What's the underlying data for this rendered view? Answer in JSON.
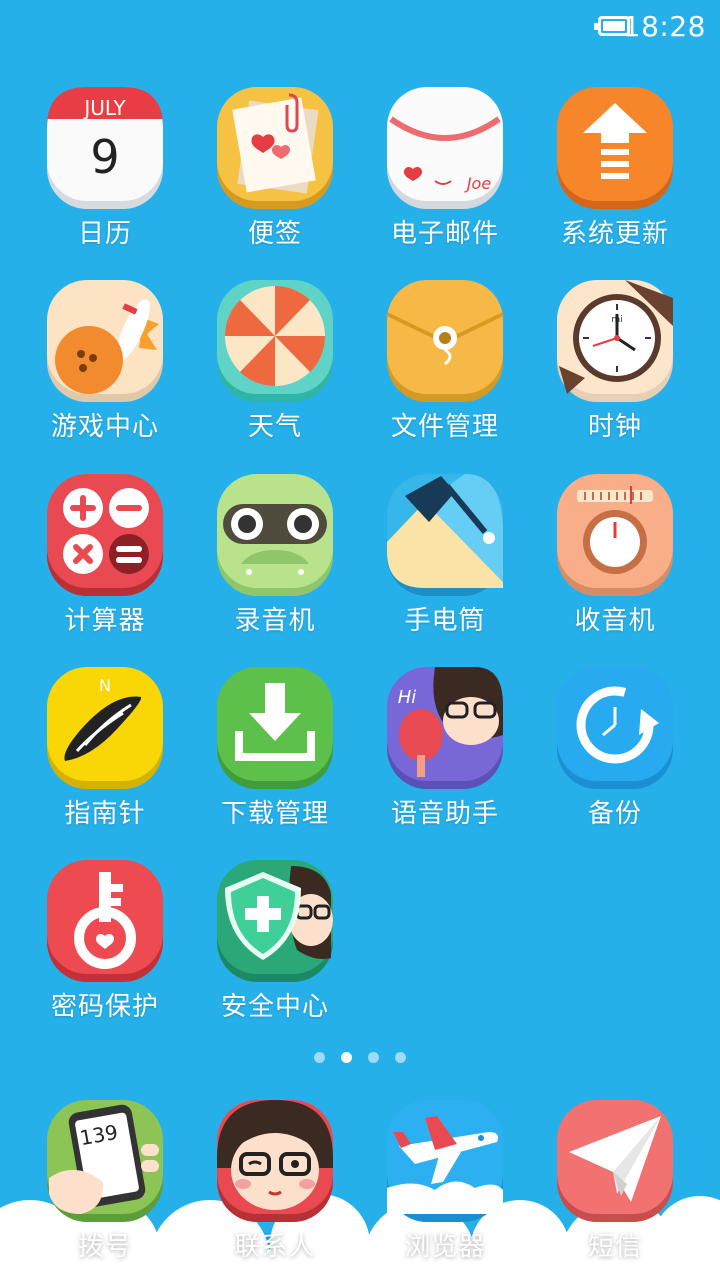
{
  "status_bar": {
    "time": "18:28",
    "battery_icon": "battery-full-icon"
  },
  "apps": [
    {
      "id": "calendar",
      "label": "日历",
      "icon": "calendar-icon",
      "month": "JULY",
      "day": "9"
    },
    {
      "id": "notes",
      "label": "便签",
      "icon": "notepad-icon"
    },
    {
      "id": "email",
      "label": "电子邮件",
      "icon": "envelope-icon",
      "sign": "Joe"
    },
    {
      "id": "system-update",
      "label": "系统更新",
      "icon": "up-arrow-icon"
    },
    {
      "id": "game-center",
      "label": "游戏中心",
      "icon": "bowling-icon"
    },
    {
      "id": "weather",
      "label": "天气",
      "icon": "pinwheel-icon"
    },
    {
      "id": "file-manager",
      "label": "文件管理",
      "icon": "folder-envelope-icon"
    },
    {
      "id": "clock",
      "label": "时钟",
      "icon": "wristwatch-icon",
      "brand": "mi"
    },
    {
      "id": "calculator",
      "label": "计算器",
      "icon": "calculator-icon"
    },
    {
      "id": "recorder",
      "label": "录音机",
      "icon": "cassette-icon"
    },
    {
      "id": "flashlight",
      "label": "手电筒",
      "icon": "desk-lamp-icon"
    },
    {
      "id": "radio",
      "label": "收音机",
      "icon": "radio-dial-icon"
    },
    {
      "id": "compass",
      "label": "指南针",
      "icon": "compass-icon",
      "north": "N"
    },
    {
      "id": "downloads",
      "label": "下载管理",
      "icon": "download-icon"
    },
    {
      "id": "voice-assistant",
      "label": "语音助手",
      "icon": "voice-assistant-icon",
      "greeting": "Hi"
    },
    {
      "id": "backup",
      "label": "备份",
      "icon": "backup-clock-icon"
    },
    {
      "id": "password",
      "label": "密码保护",
      "icon": "key-heart-icon"
    },
    {
      "id": "security",
      "label": "安全中心",
      "icon": "shield-plus-icon"
    }
  ],
  "dock": [
    {
      "id": "dialer",
      "label": "拨号",
      "icon": "phone-in-hand-icon",
      "number": "139"
    },
    {
      "id": "contacts",
      "label": "联系人",
      "icon": "girl-avatar-icon"
    },
    {
      "id": "browser",
      "label": "浏览器",
      "icon": "airplane-icon"
    },
    {
      "id": "messages",
      "label": "短信",
      "icon": "paper-plane-icon"
    }
  ],
  "page_indicator": {
    "count": 4,
    "active": 2
  },
  "colors": {
    "background": "#26b0ea",
    "text": "#ffffff"
  }
}
